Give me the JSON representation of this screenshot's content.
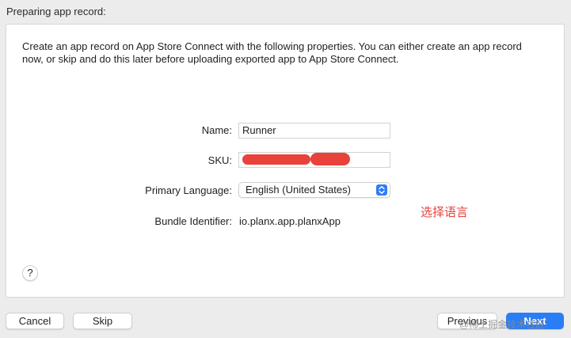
{
  "window": {
    "title": "Preparing app record:"
  },
  "panel": {
    "description": "Create an app record on App Store Connect with the following properties. You can either create an app record now, or skip and do this later before uploading exported app to App Store Connect.",
    "name_label": "Name:",
    "name_value": "Runner",
    "sku_label": "SKU:",
    "language_label": "Primary Language:",
    "language_value": "English (United States)",
    "bundle_label": "Bundle Identifier:",
    "bundle_value": "io.planx.app.planxApp",
    "annotation": "选择语言",
    "help_label": "?"
  },
  "footer": {
    "cancel_label": "Cancel",
    "skip_label": "Skip",
    "previous_label": "Previous",
    "next_label": "Next",
    "watermark": "@稀土掘金技术社区"
  },
  "colors": {
    "accent": "#2a7df5",
    "annotation": "#e8423a",
    "redaction": "#e8423a"
  },
  "icons": {
    "select_arrows": "updown-chevron-icon",
    "help": "question-icon"
  }
}
